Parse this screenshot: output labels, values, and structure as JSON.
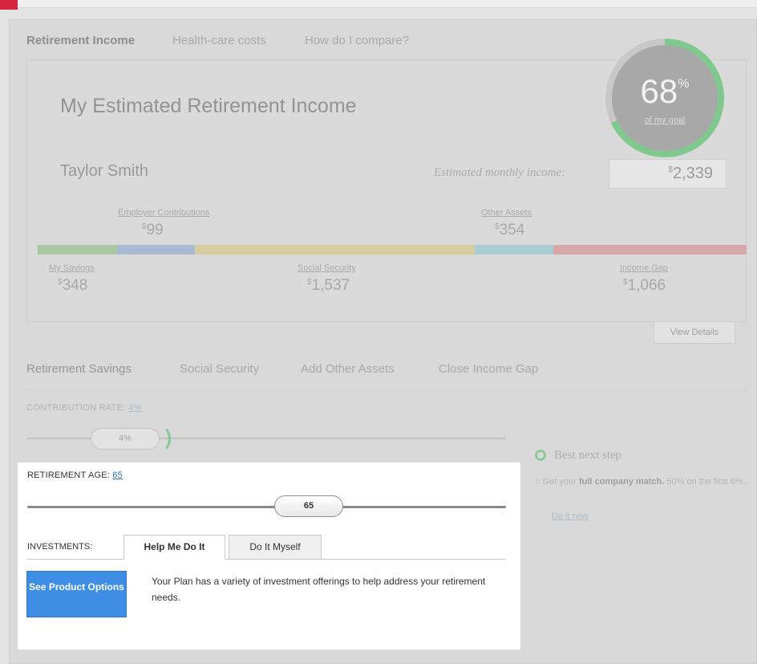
{
  "top_tabs": [
    "Retirement Income",
    "Health-care costs",
    "How do I compare?"
  ],
  "income": {
    "title": "My Estimated Retirement Income",
    "name": "Taylor Smith",
    "estimated_label": "Estimated monthly income:",
    "estimated_currency": "$",
    "estimated_value": "2,339"
  },
  "gauge": {
    "percent": "68",
    "percent_sign": "%",
    "link": "of my goal",
    "fraction": 0.68
  },
  "breakdown": {
    "employer": {
      "label": "Employer Contributions",
      "currency": "$",
      "value": "99"
    },
    "other_assets": {
      "label": "Other Assets",
      "currency": "$",
      "value": "354"
    },
    "my_savings": {
      "label": "My Savings",
      "currency": "$",
      "value": "348"
    },
    "social_security": {
      "label": "Social Security",
      "currency": "$",
      "value": "1,537"
    },
    "income_gap": {
      "label": "Income Gap",
      "currency": "$",
      "value": "1,066"
    }
  },
  "colors": {
    "my_savings": "#a8c9a0",
    "employer": "#a9bad4",
    "social_security": "#d6cda0",
    "other_assets": "#a9cdd2",
    "income_gap": "#d8a8a8",
    "accent_blue": "#3e8ee6",
    "gauge_green": "#7fc98f"
  },
  "view_details": "View Details",
  "sub_tabs": [
    "Retirement Savings",
    "Social Security",
    "Add Other Assets",
    "Close Income Gap"
  ],
  "contribution": {
    "label": "CONTRIBUTION RATE: ",
    "link": "4%",
    "knob": "4%"
  },
  "best_next_step": {
    "title": "Best next step",
    "text_pre": "Get your ",
    "text_bold": "full company match.",
    "text_post": " 50% on the first 6%.",
    "link": "Do it now"
  },
  "retirement_age": {
    "label": "RETIREMENT AGE: ",
    "link": "65",
    "knob": "65"
  },
  "investments": {
    "label": "INVESTMENTS:",
    "tab_help": "Help Me Do It",
    "tab_myself": "Do It Myself",
    "button": "See Product Options",
    "description": "Your Plan has a variety of investment offerings to help address your retirement needs."
  }
}
